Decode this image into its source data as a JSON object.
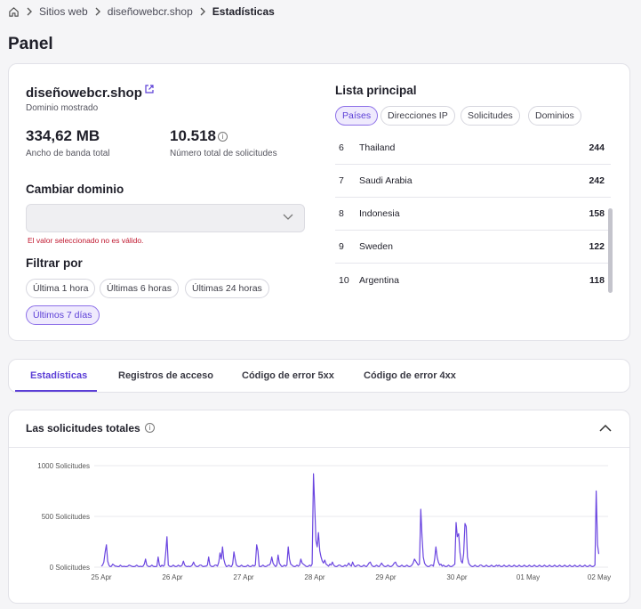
{
  "breadcrumb": {
    "items": [
      "Sitios web",
      "diseñowebcr.shop"
    ],
    "current": "Estadísticas"
  },
  "page_title": "Panel",
  "domain_card": {
    "domain": "diseñowebcr.shop",
    "domain_caption": "Dominio mostrado",
    "bandwidth_value": "334,62 MB",
    "bandwidth_label": "Ancho de banda total",
    "requests_value": "10.518",
    "requests_label": "Número total de solicitudes",
    "change_domain_heading": "Cambiar dominio",
    "select_value": "",
    "error_text": "El valor seleccionado no es válido.",
    "filter_heading": "Filtrar por",
    "filters": [
      "Última 1 hora",
      "Últimas 6 horas",
      "Últimas 24 horas",
      "Últimos 7 días"
    ],
    "active_filter": "Últimos 7 días"
  },
  "top_list": {
    "heading": "Lista principal",
    "tabs": [
      "Países",
      "Direcciones IP",
      "Solicitudes",
      "Dominios"
    ],
    "active_tab": "Países",
    "rows": [
      {
        "rank": "6",
        "name": "Thailand",
        "value": "244"
      },
      {
        "rank": "7",
        "name": "Saudi Arabia",
        "value": "242"
      },
      {
        "rank": "8",
        "name": "Indonesia",
        "value": "158"
      },
      {
        "rank": "9",
        "name": "Sweden",
        "value": "122"
      },
      {
        "rank": "10",
        "name": "Argentina",
        "value": "118"
      }
    ]
  },
  "section_tabs": {
    "items": [
      "Estadísticas",
      "Registros de acceso",
      "Código de error 5xx",
      "Código de error 4xx"
    ],
    "active": "Estadísticas"
  },
  "chart": {
    "title": "Las solicitudes totales",
    "accent_color": "#6a45e0"
  },
  "chart_data": {
    "type": "line",
    "title": "Las solicitudes totales",
    "xlabel": "",
    "ylabel": "",
    "ylim": [
      0,
      1000
    ],
    "ytick_labels": [
      "0 Solicitudes",
      "500 Solicitudes",
      "1000 Solicitudes"
    ],
    "xtick_labels": [
      "25 Apr",
      "26 Apr",
      "27 Apr",
      "28 Apr",
      "29 Apr",
      "30 Apr",
      "01 May",
      "02 May"
    ],
    "x": [
      0,
      0.5,
      1,
      1.5,
      2,
      2.5,
      3,
      3.5,
      4,
      4.5,
      5,
      5.5,
      6,
      6.5,
      7,
      7.5,
      8,
      8.5,
      9,
      9.5,
      10,
      10.5,
      11,
      11.5,
      12,
      12.5,
      13,
      13.5,
      14,
      14.5,
      15,
      15.5,
      16,
      16.5,
      17,
      17.5,
      18,
      18.5,
      19,
      19.5,
      20,
      20.5,
      21,
      21.5,
      22,
      22.5,
      23,
      23.5,
      24,
      24.5,
      25,
      25.5,
      26,
      26.5,
      27,
      27.5,
      28,
      28.5,
      29,
      29.5,
      30,
      30.5,
      31,
      31.5,
      32,
      32.5,
      33,
      33.5,
      34,
      34.5,
      35,
      35.5,
      36,
      36.5,
      37,
      37.5,
      38,
      38.5,
      39,
      39.5,
      40,
      40.5,
      41,
      41.5,
      42,
      42.5,
      43,
      43.5,
      44,
      44.5,
      45,
      45.5,
      46,
      46.5,
      47,
      47.5,
      48,
      48.5,
      49,
      49.5,
      50,
      50.5,
      51,
      51.5,
      52,
      52.5,
      53,
      53.5,
      54,
      54.5,
      55,
      55.5,
      56,
      56.5,
      57,
      57.5,
      58,
      58.5,
      59,
      59.5,
      60,
      60.5,
      61,
      61.5,
      62,
      62.5,
      63,
      63.5,
      64,
      64.5,
      65,
      65.5,
      66,
      66.5,
      67,
      67.5,
      68,
      68.5,
      69,
      69.5,
      70,
      70.5,
      71,
      71.5,
      72,
      72.5,
      73,
      73.5,
      74,
      74.5,
      75,
      75.5,
      76,
      76.5,
      77,
      77.5,
      78,
      78.5,
      79,
      79.5,
      80,
      80.5,
      81,
      81.5,
      82,
      82.5,
      83,
      83.5,
      84,
      84.5,
      85,
      85.5,
      86,
      86.5,
      87,
      87.5,
      88,
      88.5,
      89,
      89.5,
      90,
      90.5,
      91,
      91.5,
      92,
      92.5,
      93,
      93.5,
      94,
      94.5,
      95,
      95.5,
      96,
      96.5,
      97,
      97.5,
      98,
      98.5,
      99,
      99.5,
      100,
      100.5,
      101,
      101.5,
      102,
      102.5,
      103,
      103.5,
      104,
      104.5,
      105,
      105.5,
      106,
      106.5,
      107,
      107.5,
      108,
      108.5,
      109,
      109.5,
      110,
      110.5,
      111,
      111.5,
      112,
      112.5,
      113,
      113.5,
      114,
      114.5,
      115,
      115.5,
      116,
      116.5,
      117,
      117.5,
      118,
      118.5,
      119,
      119.5,
      120,
      120.5,
      121,
      121.5,
      122,
      122.5,
      123,
      123.5,
      124,
      124.5,
      125,
      125.5,
      126,
      126.5,
      127,
      127.5,
      128,
      128.5,
      129,
      129.5,
      130,
      130.5,
      131,
      131.5,
      132,
      132.5,
      133,
      133.5,
      134,
      134.5,
      135,
      135.5,
      136,
      136.5,
      137,
      137.5,
      138,
      138.5,
      139,
      139.5,
      140,
      140.5,
      141,
      141.5,
      142,
      142.5,
      143,
      143.5,
      144,
      144.5,
      145,
      145.5,
      146,
      146.5,
      147,
      147.5,
      148,
      148.5,
      149,
      149.5,
      150,
      150.5,
      151,
      151.5,
      152,
      152.5,
      153,
      153.5,
      154,
      154.5,
      155,
      155.5,
      156,
      156.5,
      157,
      157.5,
      158,
      158.5,
      159,
      159.5,
      160,
      160.5,
      161,
      161.5,
      162,
      162.5,
      163,
      163.5,
      164,
      164.5,
      165,
      165.5,
      166,
      166.5,
      167,
      167.5,
      168,
      168.5,
      169,
      169.5,
      170,
      170.5,
      171,
      171.5,
      172,
      172.5,
      173,
      173.5,
      174,
      174.5,
      175,
      175.5,
      176,
      176.5,
      177,
      177.5,
      178,
      178.5,
      179,
      179.5,
      180,
      180.5,
      181,
      181.5,
      182,
      182.5,
      183,
      183.5,
      184,
      184.5,
      185,
      185.5,
      186,
      186.5,
      187,
      187.5,
      188,
      188.5,
      189,
      189.5,
      190,
      190.5,
      191,
      191.5,
      192,
      192.5,
      193,
      193.5,
      194,
      194.5,
      195,
      195.5,
      196,
      196.5,
      197,
      197.5,
      198,
      198.5,
      199,
      199.5,
      200
    ],
    "series": [
      {
        "values": [
          10,
          20,
          50,
          150,
          220,
          60,
          20,
          5,
          10,
          30,
          20,
          10,
          10,
          5,
          5,
          20,
          10,
          5,
          10,
          5,
          5,
          10,
          20,
          15,
          10,
          5,
          5,
          10,
          20,
          10,
          5,
          10,
          5,
          10,
          30,
          80,
          20,
          10,
          5,
          10,
          20,
          10,
          5,
          5,
          10,
          100,
          20,
          5,
          20,
          10,
          20,
          140,
          300,
          20,
          10,
          5,
          10,
          20,
          10,
          5,
          10,
          20,
          10,
          10,
          20,
          60,
          20,
          10,
          5,
          10,
          5,
          10,
          20,
          50,
          20,
          10,
          5,
          10,
          20,
          20,
          10,
          5,
          10,
          10,
          20,
          100,
          20,
          10,
          5,
          10,
          20,
          20,
          10,
          50,
          140,
          80,
          200,
          80,
          30,
          5,
          10,
          20,
          10,
          5,
          30,
          150,
          80,
          20,
          10,
          5,
          10,
          20,
          10,
          5,
          5,
          10,
          20,
          10,
          5,
          10,
          20,
          10,
          20,
          220,
          160,
          10,
          5,
          10,
          20,
          10,
          5,
          10,
          20,
          20,
          40,
          100,
          40,
          20,
          5,
          20,
          120,
          40,
          20,
          5,
          10,
          20,
          10,
          20,
          200,
          80,
          30,
          20,
          10,
          5,
          10,
          20,
          10,
          20,
          80,
          40,
          30,
          20,
          10,
          5,
          10,
          20,
          10,
          30,
          920,
          600,
          260,
          200,
          340,
          160,
          100,
          60,
          40,
          70,
          30,
          20,
          10,
          30,
          20,
          50,
          20,
          10,
          5,
          10,
          20,
          20,
          10,
          5,
          10,
          20,
          10,
          20,
          40,
          20,
          10,
          50,
          20,
          5,
          10,
          20,
          20,
          10,
          5,
          10,
          20,
          10,
          5,
          20,
          40,
          50,
          20,
          10,
          5,
          10,
          20,
          10,
          5,
          20,
          40,
          20,
          10,
          5,
          10,
          20,
          10,
          5,
          10,
          20,
          40,
          50,
          20,
          10,
          5,
          10,
          20,
          10,
          5,
          10,
          20,
          10,
          5,
          10,
          20,
          40,
          80,
          60,
          40,
          20,
          30,
          570,
          300,
          100,
          40,
          20,
          10,
          5,
          10,
          20,
          20,
          10,
          80,
          200,
          100,
          50,
          20,
          30,
          10,
          20,
          10,
          5,
          10,
          20,
          10,
          5,
          10,
          20,
          30,
          440,
          300,
          330,
          150,
          60,
          40,
          130,
          430,
          400,
          100,
          40,
          20,
          10,
          5,
          10,
          20,
          10,
          5,
          10,
          20,
          20,
          10,
          5,
          10,
          20,
          10,
          5,
          10,
          20,
          10,
          5,
          10,
          20,
          10,
          20,
          10,
          5,
          10,
          20,
          10,
          5,
          10,
          20,
          10,
          5,
          10,
          20,
          10,
          5,
          10,
          20,
          10,
          5,
          10,
          20,
          10,
          5,
          10,
          20,
          10,
          5,
          10,
          20,
          10,
          5,
          10,
          20,
          10,
          5,
          10,
          20,
          10,
          5,
          10,
          20,
          10,
          5,
          10,
          20,
          10,
          5,
          10,
          20,
          10,
          5,
          10,
          20,
          10,
          5,
          10,
          20,
          10,
          5,
          10,
          20,
          10,
          5,
          10,
          20,
          10,
          5,
          10,
          20,
          10,
          5,
          10,
          20,
          10,
          5,
          10,
          20,
          750,
          220,
          130
        ]
      }
    ]
  }
}
